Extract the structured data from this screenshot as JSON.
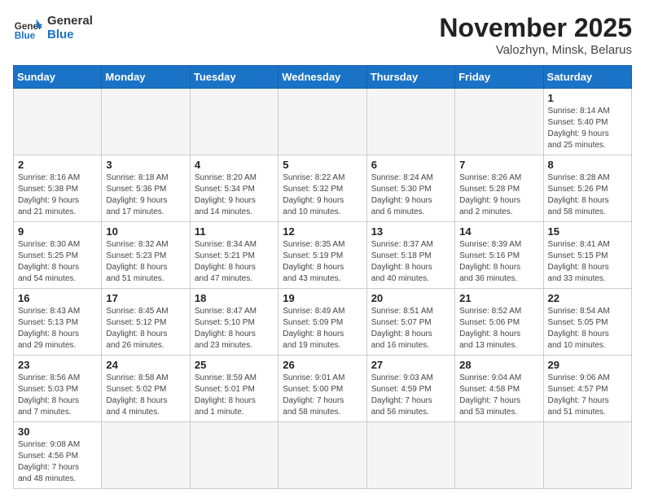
{
  "header": {
    "logo_general": "General",
    "logo_blue": "Blue",
    "month": "November 2025",
    "location": "Valozhyn, Minsk, Belarus"
  },
  "weekdays": [
    "Sunday",
    "Monday",
    "Tuesday",
    "Wednesday",
    "Thursday",
    "Friday",
    "Saturday"
  ],
  "weeks": [
    [
      {
        "day": "",
        "info": ""
      },
      {
        "day": "",
        "info": ""
      },
      {
        "day": "",
        "info": ""
      },
      {
        "day": "",
        "info": ""
      },
      {
        "day": "",
        "info": ""
      },
      {
        "day": "",
        "info": ""
      },
      {
        "day": "1",
        "info": "Sunrise: 8:14 AM\nSunset: 5:40 PM\nDaylight: 9 hours\nand 25 minutes."
      }
    ],
    [
      {
        "day": "2",
        "info": "Sunrise: 8:16 AM\nSunset: 5:38 PM\nDaylight: 9 hours\nand 21 minutes."
      },
      {
        "day": "3",
        "info": "Sunrise: 8:18 AM\nSunset: 5:36 PM\nDaylight: 9 hours\nand 17 minutes."
      },
      {
        "day": "4",
        "info": "Sunrise: 8:20 AM\nSunset: 5:34 PM\nDaylight: 9 hours\nand 14 minutes."
      },
      {
        "day": "5",
        "info": "Sunrise: 8:22 AM\nSunset: 5:32 PM\nDaylight: 9 hours\nand 10 minutes."
      },
      {
        "day": "6",
        "info": "Sunrise: 8:24 AM\nSunset: 5:30 PM\nDaylight: 9 hours\nand 6 minutes."
      },
      {
        "day": "7",
        "info": "Sunrise: 8:26 AM\nSunset: 5:28 PM\nDaylight: 9 hours\nand 2 minutes."
      },
      {
        "day": "8",
        "info": "Sunrise: 8:28 AM\nSunset: 5:26 PM\nDaylight: 8 hours\nand 58 minutes."
      }
    ],
    [
      {
        "day": "9",
        "info": "Sunrise: 8:30 AM\nSunset: 5:25 PM\nDaylight: 8 hours\nand 54 minutes."
      },
      {
        "day": "10",
        "info": "Sunrise: 8:32 AM\nSunset: 5:23 PM\nDaylight: 8 hours\nand 51 minutes."
      },
      {
        "day": "11",
        "info": "Sunrise: 8:34 AM\nSunset: 5:21 PM\nDaylight: 8 hours\nand 47 minutes."
      },
      {
        "day": "12",
        "info": "Sunrise: 8:35 AM\nSunset: 5:19 PM\nDaylight: 8 hours\nand 43 minutes."
      },
      {
        "day": "13",
        "info": "Sunrise: 8:37 AM\nSunset: 5:18 PM\nDaylight: 8 hours\nand 40 minutes."
      },
      {
        "day": "14",
        "info": "Sunrise: 8:39 AM\nSunset: 5:16 PM\nDaylight: 8 hours\nand 36 minutes."
      },
      {
        "day": "15",
        "info": "Sunrise: 8:41 AM\nSunset: 5:15 PM\nDaylight: 8 hours\nand 33 minutes."
      }
    ],
    [
      {
        "day": "16",
        "info": "Sunrise: 8:43 AM\nSunset: 5:13 PM\nDaylight: 8 hours\nand 29 minutes."
      },
      {
        "day": "17",
        "info": "Sunrise: 8:45 AM\nSunset: 5:12 PM\nDaylight: 8 hours\nand 26 minutes."
      },
      {
        "day": "18",
        "info": "Sunrise: 8:47 AM\nSunset: 5:10 PM\nDaylight: 8 hours\nand 23 minutes."
      },
      {
        "day": "19",
        "info": "Sunrise: 8:49 AM\nSunset: 5:09 PM\nDaylight: 8 hours\nand 19 minutes."
      },
      {
        "day": "20",
        "info": "Sunrise: 8:51 AM\nSunset: 5:07 PM\nDaylight: 8 hours\nand 16 minutes."
      },
      {
        "day": "21",
        "info": "Sunrise: 8:52 AM\nSunset: 5:06 PM\nDaylight: 8 hours\nand 13 minutes."
      },
      {
        "day": "22",
        "info": "Sunrise: 8:54 AM\nSunset: 5:05 PM\nDaylight: 8 hours\nand 10 minutes."
      }
    ],
    [
      {
        "day": "23",
        "info": "Sunrise: 8:56 AM\nSunset: 5:03 PM\nDaylight: 8 hours\nand 7 minutes."
      },
      {
        "day": "24",
        "info": "Sunrise: 8:58 AM\nSunset: 5:02 PM\nDaylight: 8 hours\nand 4 minutes."
      },
      {
        "day": "25",
        "info": "Sunrise: 8:59 AM\nSunset: 5:01 PM\nDaylight: 8 hours\nand 1 minute."
      },
      {
        "day": "26",
        "info": "Sunrise: 9:01 AM\nSunset: 5:00 PM\nDaylight: 7 hours\nand 58 minutes."
      },
      {
        "day": "27",
        "info": "Sunrise: 9:03 AM\nSunset: 4:59 PM\nDaylight: 7 hours\nand 56 minutes."
      },
      {
        "day": "28",
        "info": "Sunrise: 9:04 AM\nSunset: 4:58 PM\nDaylight: 7 hours\nand 53 minutes."
      },
      {
        "day": "29",
        "info": "Sunrise: 9:06 AM\nSunset: 4:57 PM\nDaylight: 7 hours\nand 51 minutes."
      }
    ],
    [
      {
        "day": "30",
        "info": "Sunrise: 9:08 AM\nSunset: 4:56 PM\nDaylight: 7 hours\nand 48 minutes."
      },
      {
        "day": "",
        "info": ""
      },
      {
        "day": "",
        "info": ""
      },
      {
        "day": "",
        "info": ""
      },
      {
        "day": "",
        "info": ""
      },
      {
        "day": "",
        "info": ""
      },
      {
        "day": "",
        "info": ""
      }
    ]
  ]
}
